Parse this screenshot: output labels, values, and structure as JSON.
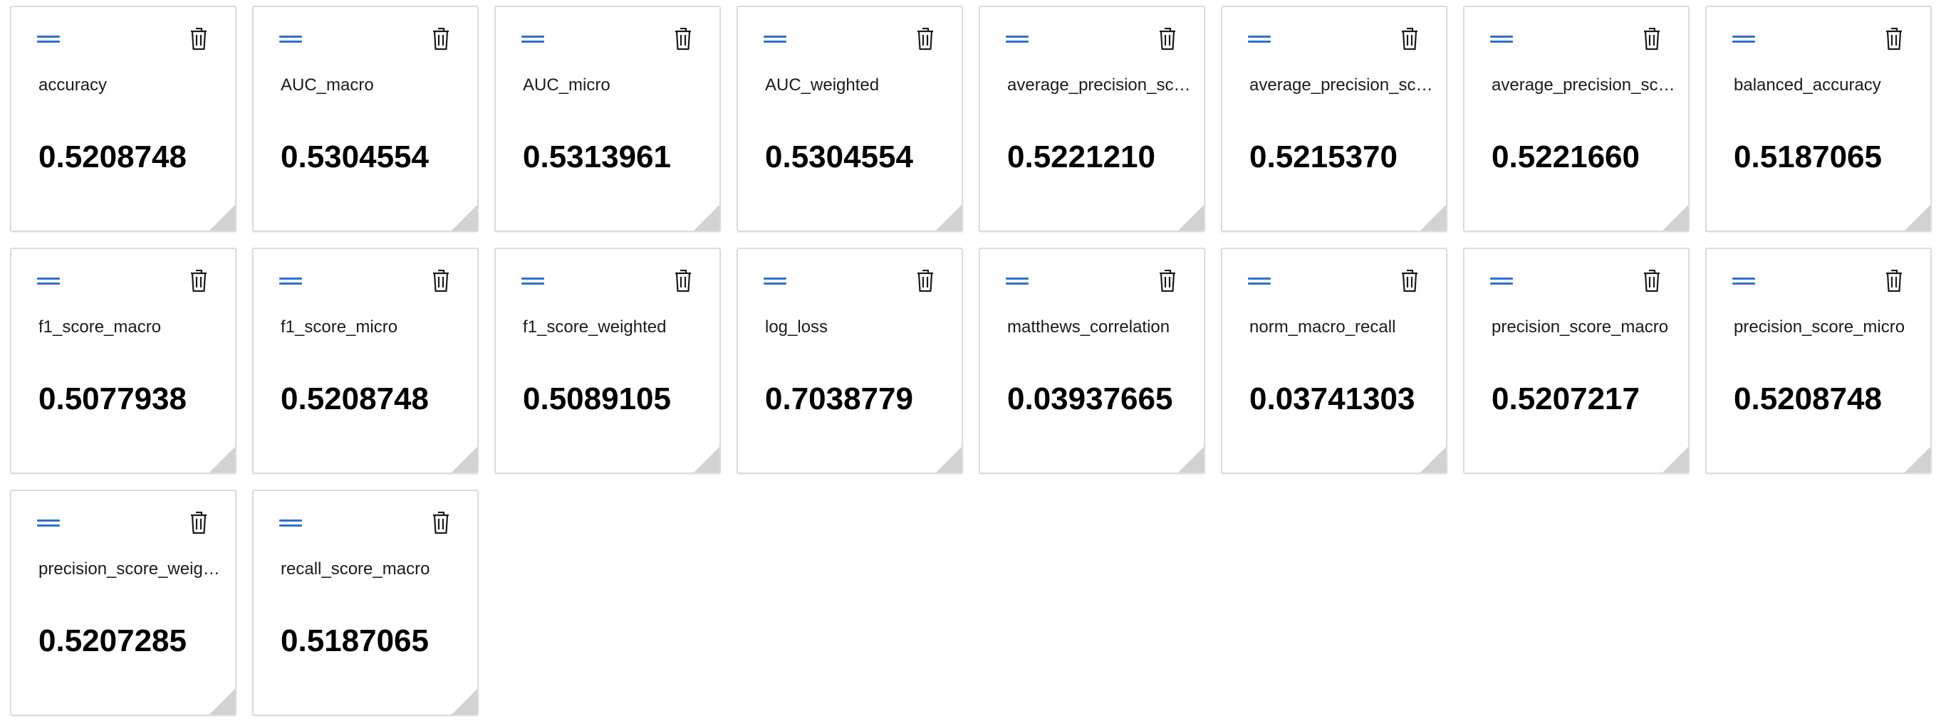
{
  "colors": {
    "accent": "#2f6fd1",
    "tile_border": "#dcdcdc",
    "resize_handle": "#d2d2d2"
  },
  "icons": {
    "drag": "drag-handle-icon",
    "delete": "trash-icon",
    "resize": "resize-handle-icon"
  },
  "tiles": [
    {
      "name": "accuracy",
      "value": "0.5208748"
    },
    {
      "name": "AUC_macro",
      "value": "0.5304554"
    },
    {
      "name": "AUC_micro",
      "value": "0.5313961"
    },
    {
      "name": "AUC_weighted",
      "value": "0.5304554"
    },
    {
      "name": "average_precision_sco...",
      "value": "0.5221210"
    },
    {
      "name": "average_precision_sco...",
      "value": "0.5215370"
    },
    {
      "name": "average_precision_sco...",
      "value": "0.5221660"
    },
    {
      "name": "balanced_accuracy",
      "value": "0.5187065"
    },
    {
      "name": "f1_score_macro",
      "value": "0.5077938"
    },
    {
      "name": "f1_score_micro",
      "value": "0.5208748"
    },
    {
      "name": "f1_score_weighted",
      "value": "0.5089105"
    },
    {
      "name": "log_loss",
      "value": "0.7038779"
    },
    {
      "name": "matthews_correlation",
      "value": "0.03937665"
    },
    {
      "name": "norm_macro_recall",
      "value": "0.03741303"
    },
    {
      "name": "precision_score_macro",
      "value": "0.5207217"
    },
    {
      "name": "precision_score_micro",
      "value": "0.5208748"
    },
    {
      "name": "precision_score_weigh...",
      "value": "0.5207285"
    },
    {
      "name": "recall_score_macro",
      "value": "0.5187065"
    }
  ]
}
